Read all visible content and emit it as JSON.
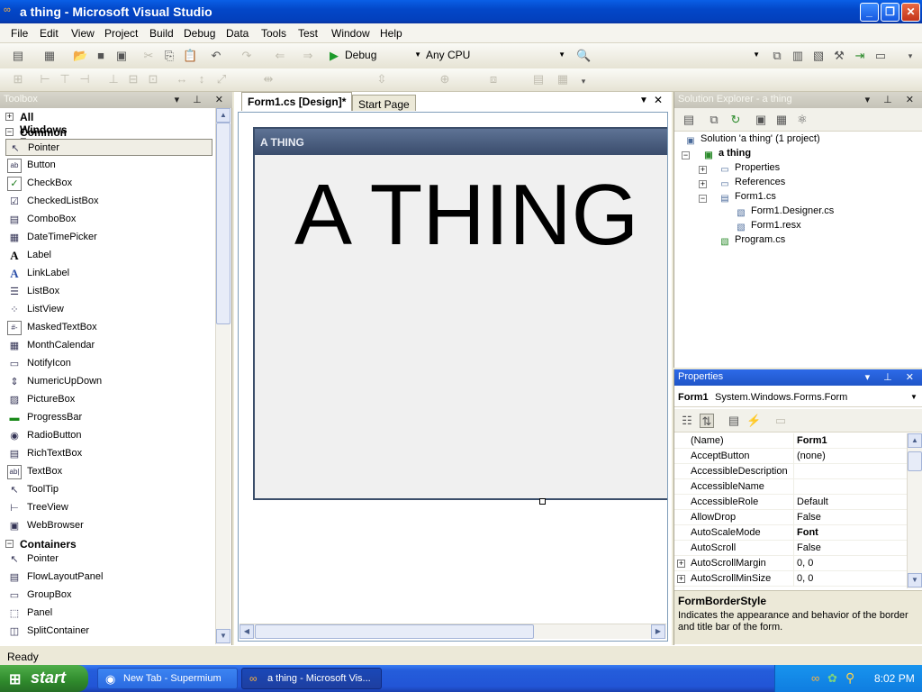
{
  "window": {
    "title": "a thing - Microsoft Visual Studio",
    "min_label": "_",
    "max_label": "❐",
    "close_label": "✕"
  },
  "menu": [
    "File",
    "Edit",
    "View",
    "Project",
    "Build",
    "Debug",
    "Data",
    "Tools",
    "Test",
    "Window",
    "Help"
  ],
  "toolbar": {
    "config": "Debug",
    "platform": "Any CPU"
  },
  "toolbox": {
    "title": "Toolbox",
    "groups": {
      "all": "All Windows Forms",
      "common": "Common Controls",
      "containers": "Containers"
    },
    "common_items": [
      "Pointer",
      "Button",
      "CheckBox",
      "CheckedListBox",
      "ComboBox",
      "DateTimePicker",
      "Label",
      "LinkLabel",
      "ListBox",
      "ListView",
      "MaskedTextBox",
      "MonthCalendar",
      "NotifyIcon",
      "NumericUpDown",
      "PictureBox",
      "ProgressBar",
      "RadioButton",
      "RichTextBox",
      "TextBox",
      "ToolTip",
      "TreeView",
      "WebBrowser"
    ],
    "container_items": [
      "Pointer",
      "FlowLayoutPanel",
      "GroupBox",
      "Panel",
      "SplitContainer"
    ]
  },
  "document": {
    "tabs": {
      "active": "Form1.cs [Design]*",
      "other": "Start Page"
    },
    "form_caption": "A THING",
    "form_text": "A THING"
  },
  "solution_explorer": {
    "title": "Solution Explorer - a thing",
    "solution": "Solution 'a thing' (1 project)",
    "project": "a thing",
    "properties": "Properties",
    "references": "References",
    "form1": "Form1.cs",
    "designer": "Form1.Designer.cs",
    "resx": "Form1.resx",
    "program": "Program.cs"
  },
  "properties": {
    "title": "Properties",
    "object_name": "Form1",
    "object_type": "System.Windows.Forms.Form",
    "rows": [
      {
        "name": "(Name)",
        "value": "Form1"
      },
      {
        "name": "AcceptButton",
        "value": "(none)"
      },
      {
        "name": "AccessibleDescription",
        "value": ""
      },
      {
        "name": "AccessibleName",
        "value": ""
      },
      {
        "name": "AccessibleRole",
        "value": "Default"
      },
      {
        "name": "AllowDrop",
        "value": "False"
      },
      {
        "name": "AutoScaleMode",
        "value": "Font"
      },
      {
        "name": "AutoScroll",
        "value": "False"
      },
      {
        "name": "AutoScrollMargin",
        "value": "0, 0"
      },
      {
        "name": "AutoScrollMinSize",
        "value": "0, 0"
      }
    ],
    "desc_title": "FormBorderStyle",
    "desc_text": "Indicates the appearance and behavior of the border and title bar of the form."
  },
  "status": {
    "text": "Ready"
  },
  "taskbar": {
    "start": "start",
    "tasks": [
      "New Tab - Supermium",
      "a thing - Microsoft Vis..."
    ],
    "clock": "8:02 PM"
  }
}
